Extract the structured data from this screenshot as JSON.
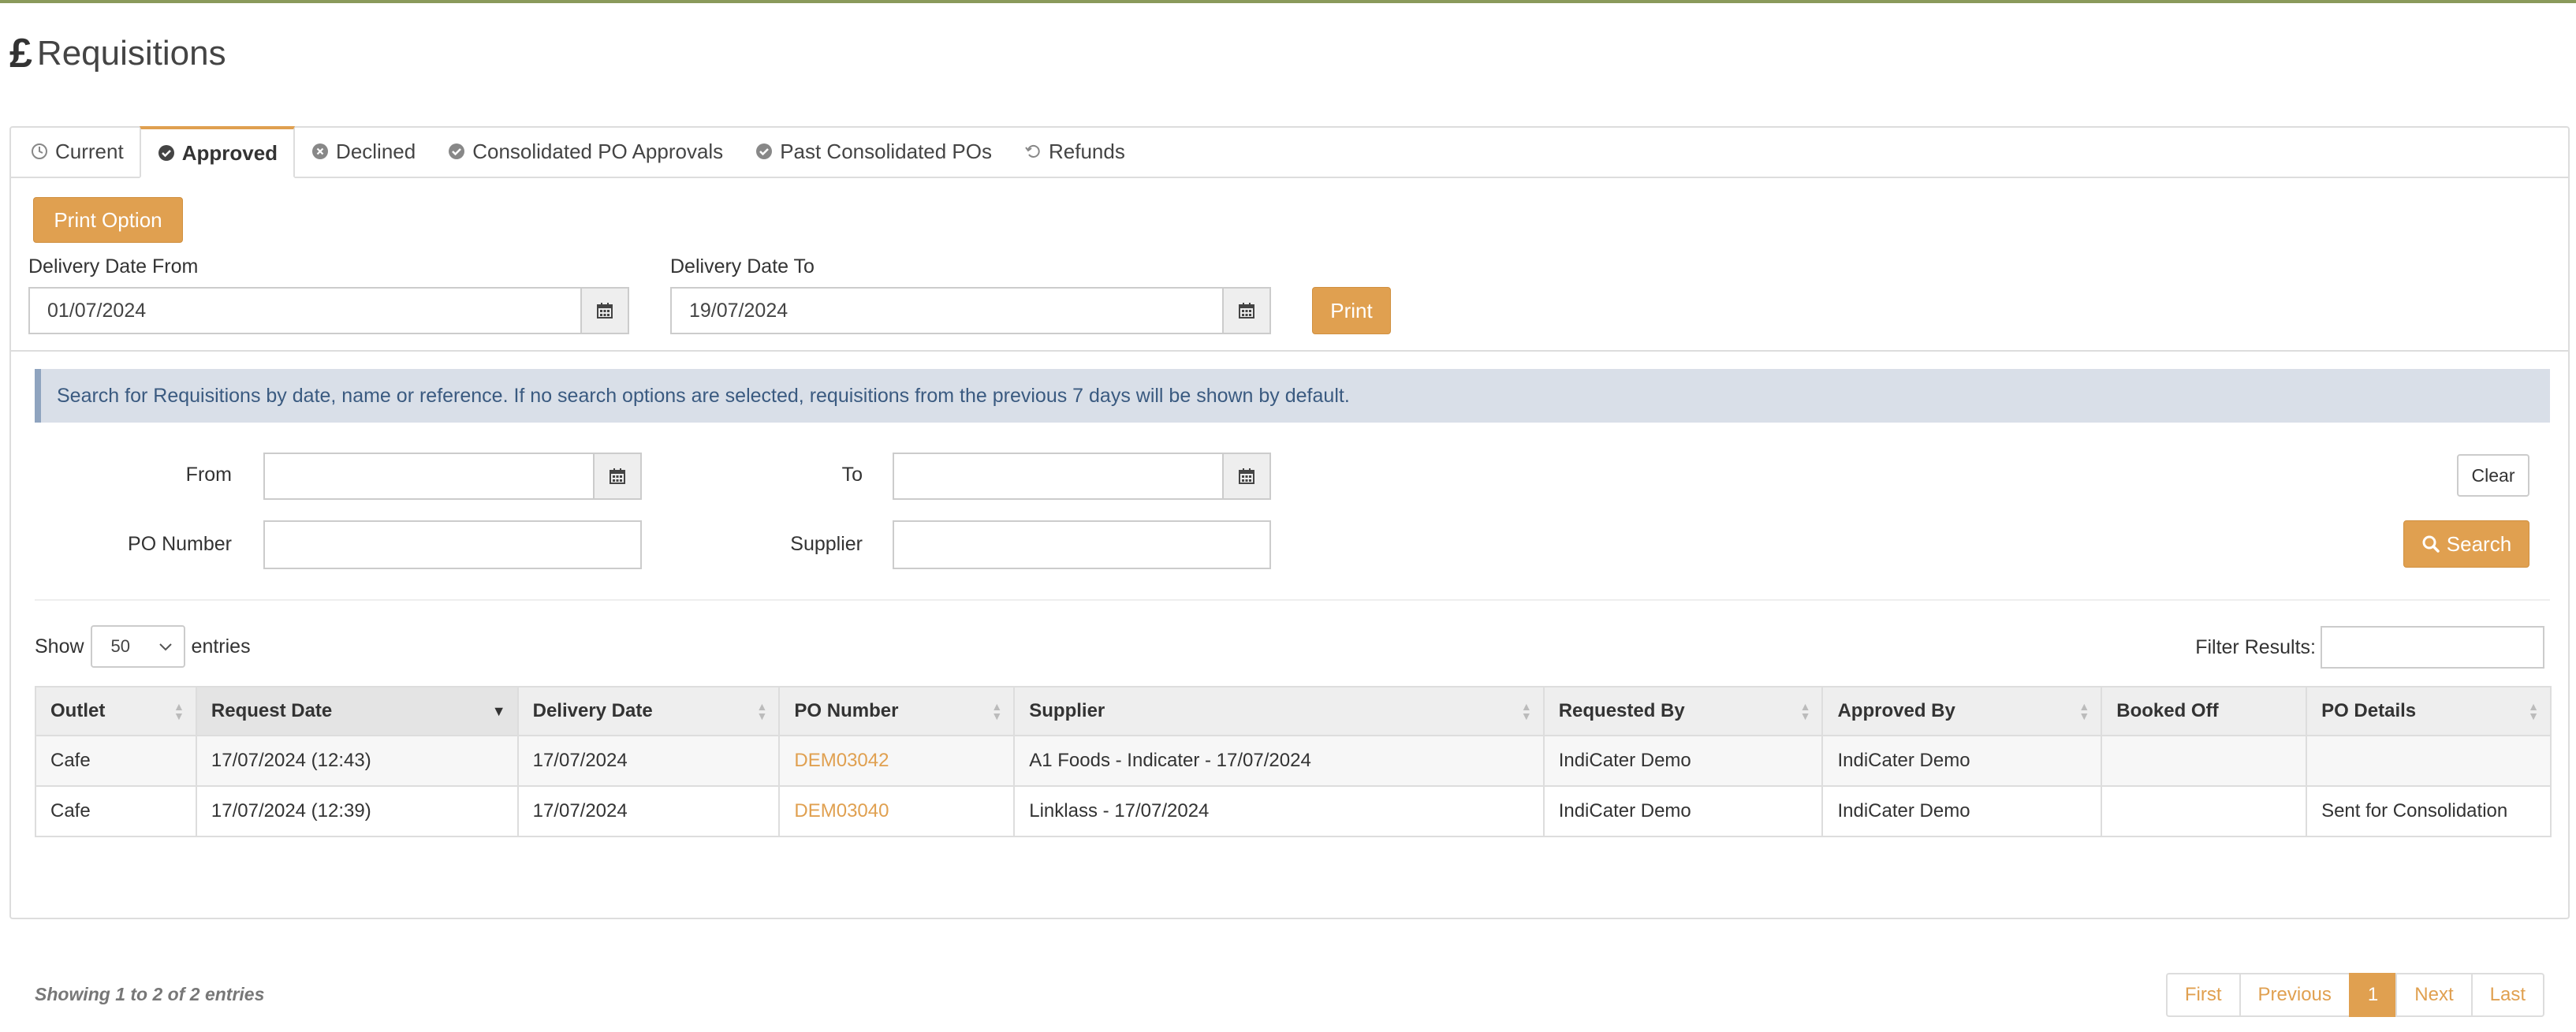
{
  "header": {
    "currency_symbol": "£",
    "title": "Requisitions"
  },
  "tabs": [
    {
      "label": "Current",
      "icon": "clock-icon"
    },
    {
      "label": "Approved",
      "icon": "check-circle-icon"
    },
    {
      "label": "Declined",
      "icon": "x-circle-icon"
    },
    {
      "label": "Consolidated PO Approvals",
      "icon": "check-circle-icon"
    },
    {
      "label": "Past Consolidated POs",
      "icon": "check-circle-icon"
    },
    {
      "label": "Refunds",
      "icon": "undo-icon"
    }
  ],
  "print_section": {
    "print_option_label": "Print Option",
    "delivery_from_label": "Delivery Date From",
    "delivery_from_value": "01/07/2024",
    "delivery_to_label": "Delivery Date To",
    "delivery_to_value": "19/07/2024",
    "print_label": "Print"
  },
  "info_text": "Search for Requisitions by date, name or reference. If no search options are selected, requisitions from the previous 7 days will be shown by default.",
  "search": {
    "from_label": "From",
    "to_label": "To",
    "po_number_label": "PO Number",
    "supplier_label": "Supplier",
    "clear_label": "Clear",
    "search_label": "Search"
  },
  "table_controls": {
    "show_label": "Show",
    "entries_value": "50",
    "entries_label": "entries",
    "filter_label": "Filter Results:"
  },
  "table": {
    "columns": [
      "Outlet",
      "Request Date",
      "Delivery Date",
      "PO Number",
      "Supplier",
      "Requested By",
      "Approved By",
      "Booked Off",
      "PO Details"
    ],
    "rows": [
      [
        "Cafe",
        "17/07/2024 (12:43)",
        "17/07/2024",
        "DEM03042",
        "A1 Foods - Indicater - 17/07/2024",
        "IndiCater Demo",
        "IndiCater Demo",
        "",
        ""
      ],
      [
        "Cafe",
        "17/07/2024 (12:39)",
        "17/07/2024",
        "DEM03040",
        "Linklass - 17/07/2024",
        "IndiCater Demo",
        "IndiCater Demo",
        "",
        "Sent for Consolidation"
      ]
    ]
  },
  "footer": {
    "showing_text": "Showing 1 to 2 of 2 entries",
    "pagination": {
      "first": "First",
      "previous": "Previous",
      "current": "1",
      "next": "Next",
      "last": "Last"
    }
  },
  "colors": {
    "accent": "#e0a050",
    "info_bg": "#d9dfe8",
    "info_text": "#3a5a80",
    "top_line": "#8a9a5b"
  }
}
